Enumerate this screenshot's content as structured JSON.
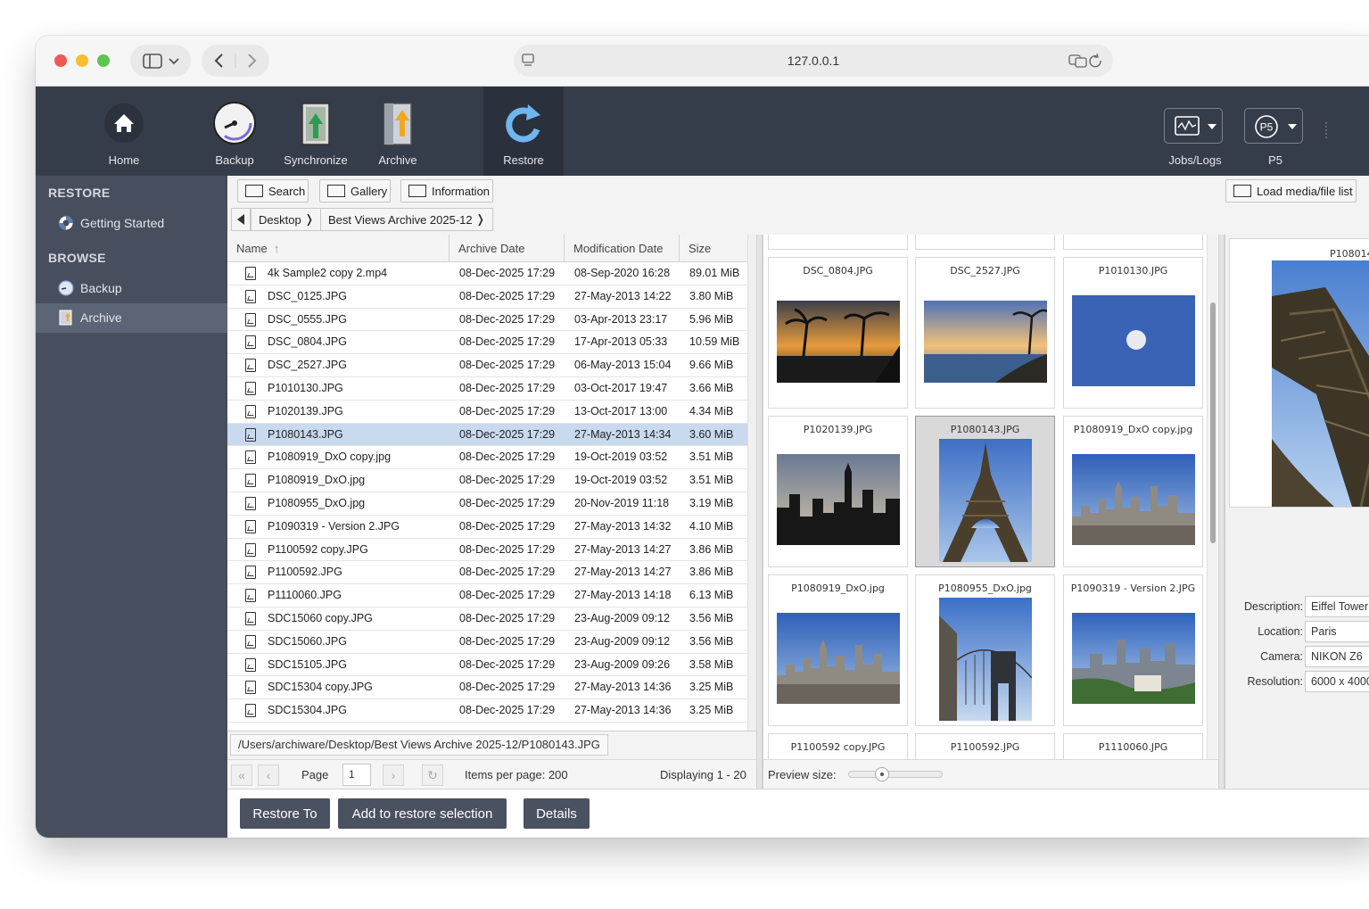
{
  "browser": {
    "url": "127.0.0.1"
  },
  "toolbar": {
    "home": "Home",
    "backup": "Backup",
    "synchronize": "Synchronize",
    "archive": "Archive",
    "restore": "Restore",
    "jobs_logs": "Jobs/Logs",
    "p5": "P5",
    "p5_badge": "P5"
  },
  "sidebar": {
    "restore_heading": "RESTORE",
    "getting_started": "Getting Started",
    "browse_heading": "BROWSE",
    "backup": "Backup",
    "archive": "Archive"
  },
  "viewbar": {
    "search": "Search",
    "gallery": "Gallery",
    "information": "Information",
    "load_list": "Load media/file list"
  },
  "breadcrumb": [
    "Desktop",
    "Best Views Archive 2025-12"
  ],
  "table": {
    "columns": [
      "Name",
      "Archive Date",
      "Modification Date",
      "Size"
    ],
    "rows": [
      {
        "name": "4k Sample2 copy 2.mp4",
        "archived": "08-Dec-2025 17:29",
        "modified": "08-Sep-2020 16:28",
        "size": "89.01 MiB"
      },
      {
        "name": "DSC_0125.JPG",
        "archived": "08-Dec-2025 17:29",
        "modified": "27-May-2013 14:22",
        "size": "3.80 MiB"
      },
      {
        "name": "DSC_0555.JPG",
        "archived": "08-Dec-2025 17:29",
        "modified": "03-Apr-2013 23:17",
        "size": "5.96 MiB"
      },
      {
        "name": "DSC_0804.JPG",
        "archived": "08-Dec-2025 17:29",
        "modified": "17-Apr-2013 05:33",
        "size": "10.59 MiB"
      },
      {
        "name": "DSC_2527.JPG",
        "archived": "08-Dec-2025 17:29",
        "modified": "06-May-2013 15:04",
        "size": "9.66 MiB"
      },
      {
        "name": "P1010130.JPG",
        "archived": "08-Dec-2025 17:29",
        "modified": "03-Oct-2017 19:47",
        "size": "3.66 MiB"
      },
      {
        "name": "P1020139.JPG",
        "archived": "08-Dec-2025 17:29",
        "modified": "13-Oct-2017 13:00",
        "size": "4.34 MiB"
      },
      {
        "name": "P1080143.JPG",
        "archived": "08-Dec-2025 17:29",
        "modified": "27-May-2013 14:34",
        "size": "3.60 MiB"
      },
      {
        "name": "P1080919_DxO copy.jpg",
        "archived": "08-Dec-2025 17:29",
        "modified": "19-Oct-2019 03:52",
        "size": "3.51 MiB"
      },
      {
        "name": "P1080919_DxO.jpg",
        "archived": "08-Dec-2025 17:29",
        "modified": "19-Oct-2019 03:52",
        "size": "3.51 MiB"
      },
      {
        "name": "P1080955_DxO.jpg",
        "archived": "08-Dec-2025 17:29",
        "modified": "20-Nov-2019 11:18",
        "size": "3.19 MiB"
      },
      {
        "name": "P1090319 - Version 2.JPG",
        "archived": "08-Dec-2025 17:29",
        "modified": "27-May-2013 14:32",
        "size": "4.10 MiB"
      },
      {
        "name": "P1100592 copy.JPG",
        "archived": "08-Dec-2025 17:29",
        "modified": "27-May-2013 14:27",
        "size": "3.86 MiB"
      },
      {
        "name": "P1100592.JPG",
        "archived": "08-Dec-2025 17:29",
        "modified": "27-May-2013 14:27",
        "size": "3.86 MiB"
      },
      {
        "name": "P1110060.JPG",
        "archived": "08-Dec-2025 17:29",
        "modified": "27-May-2013 14:18",
        "size": "6.13 MiB"
      },
      {
        "name": "SDC15060 copy.JPG",
        "archived": "08-Dec-2025 17:29",
        "modified": "23-Aug-2009 09:12",
        "size": "3.56 MiB"
      },
      {
        "name": "SDC15060.JPG",
        "archived": "08-Dec-2025 17:29",
        "modified": "23-Aug-2009 09:12",
        "size": "3.56 MiB"
      },
      {
        "name": "SDC15105.JPG",
        "archived": "08-Dec-2025 17:29",
        "modified": "23-Aug-2009 09:26",
        "size": "3.58 MiB"
      },
      {
        "name": "SDC15304 copy.JPG",
        "archived": "08-Dec-2025 17:29",
        "modified": "27-May-2013 14:36",
        "size": "3.25 MiB"
      },
      {
        "name": "SDC15304.JPG",
        "archived": "08-Dec-2025 17:29",
        "modified": "27-May-2013 14:36",
        "size": "3.25 MiB"
      }
    ],
    "selected_row": "P1080143.JPG"
  },
  "path": "/Users/archiware/Desktop/Best Views Archive 2025-12/P1080143.JPG",
  "pager": {
    "page_label": "Page",
    "page_value": "1",
    "items_per_page": "Items per page: 200",
    "displaying": "Displaying 1 - 20"
  },
  "gallery": {
    "tiles": [
      {
        "name": "DSC_0804.JPG",
        "kind": "sunset-palms"
      },
      {
        "name": "DSC_2527.JPG",
        "kind": "beach-sunset"
      },
      {
        "name": "P1010130.JPG",
        "kind": "moon"
      },
      {
        "name": "P1020139.JPG",
        "kind": "skyline-dusk"
      },
      {
        "name": "P1080143.JPG",
        "kind": "eiffel"
      },
      {
        "name": "P1080919_DxO copy.jpg",
        "kind": "city"
      },
      {
        "name": "P1080919_DxO.jpg",
        "kind": "city"
      },
      {
        "name": "P1080955_DxO.jpg",
        "kind": "bridge"
      },
      {
        "name": "P1090319 - Version 2.JPG",
        "kind": "city-green"
      },
      {
        "name": "P1100592 copy.JPG",
        "kind": "none"
      },
      {
        "name": "P1100592.JPG",
        "kind": "none"
      },
      {
        "name": "P1110060.JPG",
        "kind": "none"
      }
    ],
    "preview_size_label": "Preview size:",
    "preview_size_level": 0.35
  },
  "preview": {
    "title": "P108014",
    "fields": [
      {
        "key": "Description:",
        "value": "Eiffel Tower"
      },
      {
        "key": "Location:",
        "value": "Paris"
      },
      {
        "key": "Camera:",
        "value": "NIKON Z6"
      },
      {
        "key": "Resolution:",
        "value": "6000 x 4000"
      }
    ]
  },
  "actions": {
    "restore_to": "Restore To",
    "add_to_selection": "Add to restore selection",
    "details": "Details"
  }
}
